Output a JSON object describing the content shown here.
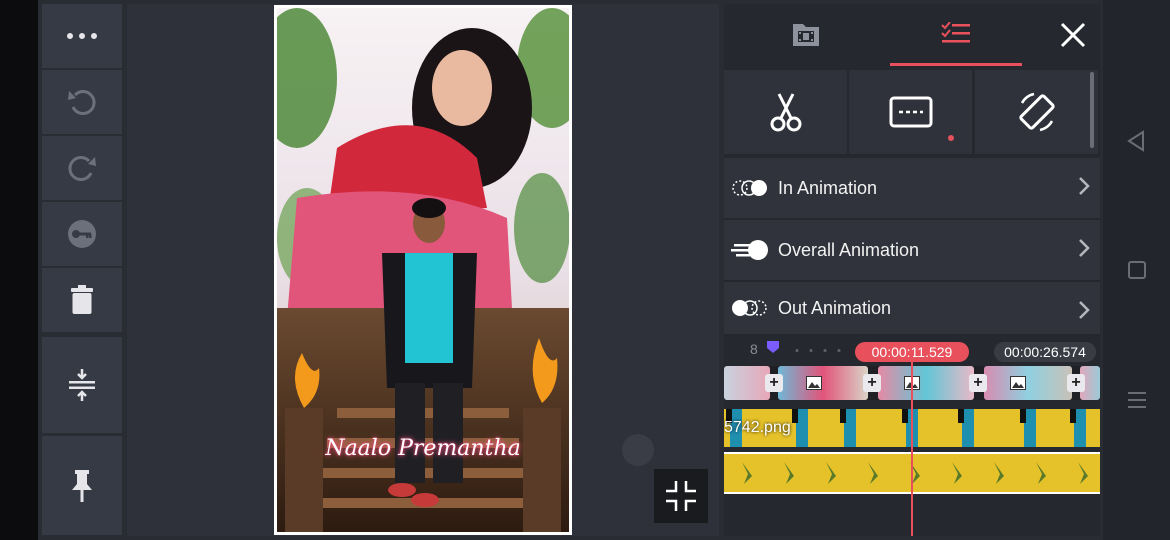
{
  "toolbar": {
    "more_icon": "more-horizontal-icon",
    "undo_icon": "undo-icon",
    "redo_icon": "redo-icon",
    "keyframe_icon": "keyframe-key-icon",
    "delete_icon": "trash-icon",
    "adjust_icon": "split-adjust-icon",
    "pin_icon": "pin-icon"
  },
  "preview": {
    "overlay_text": "Naalo Premantha",
    "fit_icon": "collapse-arrows-icon"
  },
  "tabs": [
    {
      "icon": "media-film-icon",
      "active": false
    },
    {
      "icon": "layer-list-icon",
      "active": true
    }
  ],
  "close_icon": "close-icon",
  "edit_tools": [
    {
      "icon": "scissors-icon",
      "dot": false
    },
    {
      "icon": "caption-box-icon",
      "dot": true
    },
    {
      "icon": "rotate-screen-icon",
      "dot": false
    }
  ],
  "animations": [
    {
      "label": "In Animation",
      "icon": "in-animation-icon"
    },
    {
      "label": "Overall Animation",
      "icon": "overall-animation-icon"
    },
    {
      "label": "Out Animation",
      "icon": "out-animation-icon"
    }
  ],
  "timeline": {
    "ruler_number": "8",
    "current_time": "00:00:11.529",
    "total_time": "00:00:26.574",
    "layer_label": "5742.png"
  },
  "colors": {
    "accent": "#e8505b",
    "layer_yellow": "#e6c22a",
    "marker_purple": "#7a5cff"
  }
}
